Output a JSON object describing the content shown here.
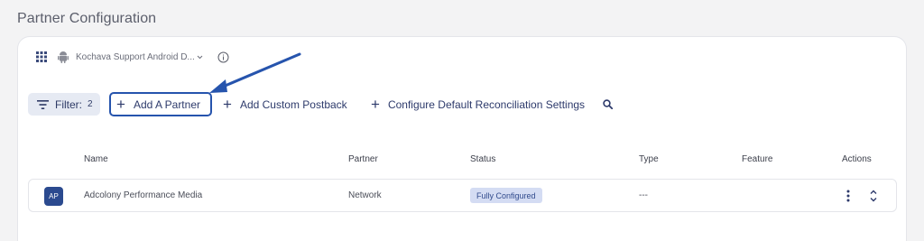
{
  "page": {
    "title": "Partner Configuration"
  },
  "app_selector": {
    "app_name": "Kochava Support Android D...",
    "icons": [
      "grid-icon",
      "android-icon",
      "chevron-down-icon",
      "info-icon"
    ]
  },
  "toolbar": {
    "filter_label": "Filter:",
    "filter_count": "2",
    "add_partner": "Add A Partner",
    "add_custom_postback": "Add Custom Postback",
    "configure_defaults": "Configure Default Reconciliation Settings",
    "plus_glyph": "+"
  },
  "table": {
    "columns": [
      "Name",
      "Partner",
      "Status",
      "Type",
      "Feature",
      "Actions"
    ],
    "rows": [
      {
        "avatar": "AP",
        "name": "Adcolony Performance Media",
        "partner": "Network",
        "status": "Fully Configured",
        "type": "---",
        "feature": ""
      }
    ]
  },
  "colors": {
    "accent": "#2654ad",
    "text_primary": "#2d3a6b",
    "badge_bg": "#d4dcf3",
    "avatar_bg": "#2b4a8f",
    "page_bg": "#f3f3f4"
  }
}
